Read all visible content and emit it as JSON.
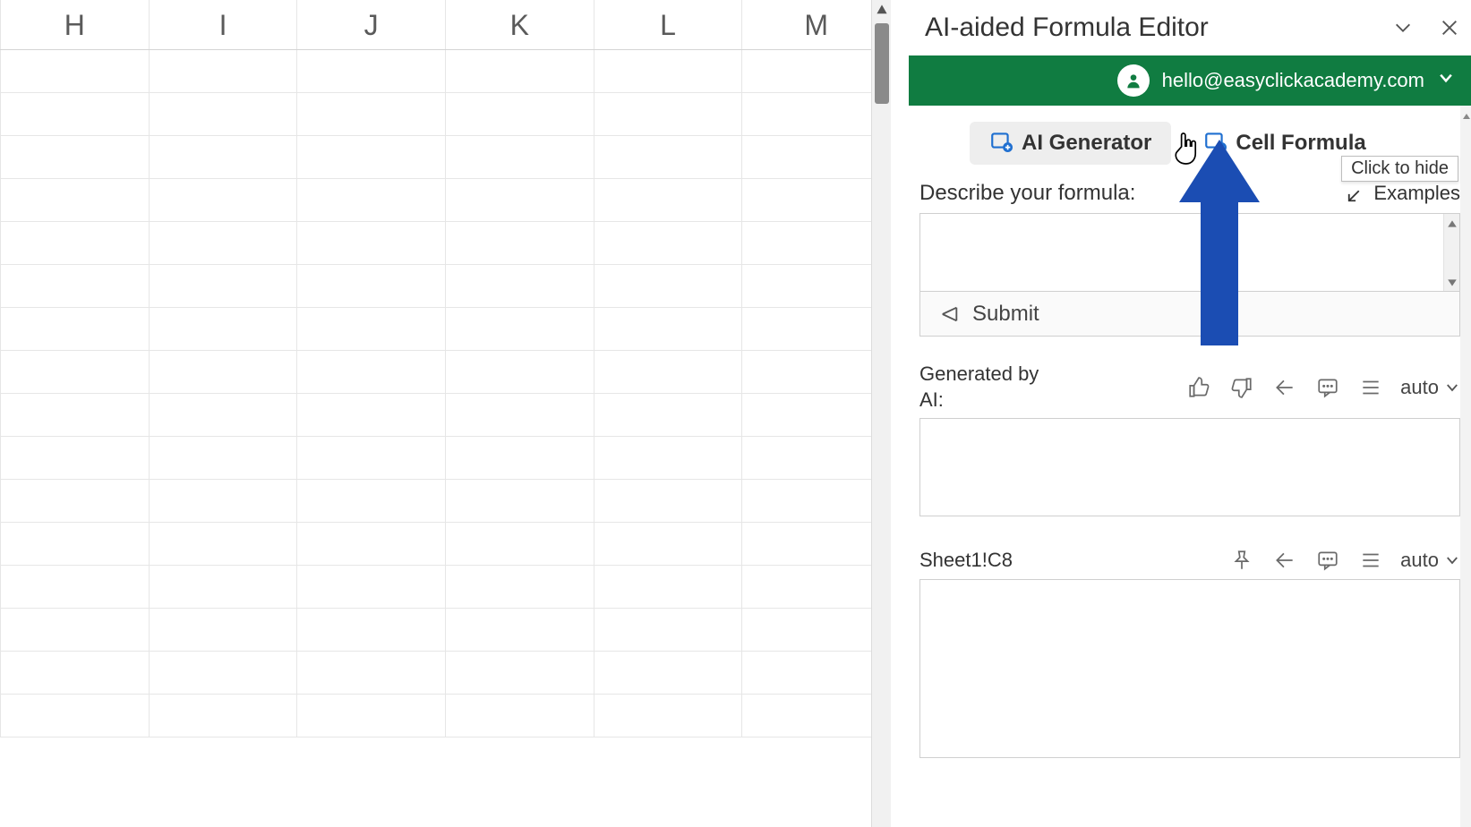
{
  "grid": {
    "columns": [
      "H",
      "I",
      "J",
      "K",
      "L",
      "M"
    ],
    "row_count": 16
  },
  "panel": {
    "title": "AI-aided Formula Editor",
    "account_email": "hello@easyclickacademy.com",
    "tabs": {
      "ai_generator": "AI Generator",
      "cell_formula": "Cell Formula"
    },
    "describe_label": "Describe your formula:",
    "examples_link": "Examples",
    "submit_label": "Submit",
    "generated_label": "Generated by AI:",
    "auto_label1": "auto",
    "sheet_ref": "Sheet1!C8",
    "auto_label2": "auto",
    "tooltip_text": "Click to hide"
  }
}
